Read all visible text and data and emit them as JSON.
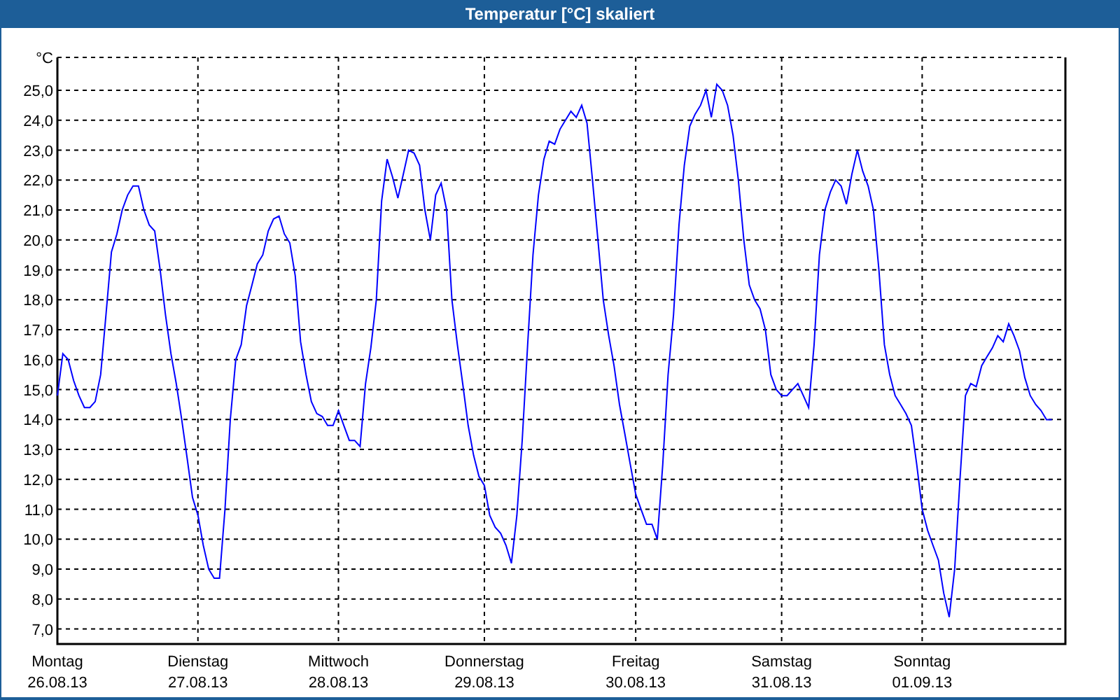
{
  "window": {
    "title": "Temperatur [°C] skaliert"
  },
  "chart": {
    "chart_data": {
      "type": "line",
      "grid": true,
      "ylabel": "°C",
      "ylim": [
        6.5,
        26.1
      ],
      "yticks": [
        {
          "value": 7,
          "label": "7,0"
        },
        {
          "value": 8,
          "label": "8,0"
        },
        {
          "value": 9,
          "label": "9,0"
        },
        {
          "value": 10,
          "label": "10,0"
        },
        {
          "value": 11,
          "label": "11,0"
        },
        {
          "value": 12,
          "label": "12,0"
        },
        {
          "value": 13,
          "label": "13,0"
        },
        {
          "value": 14,
          "label": "14,0"
        },
        {
          "value": 15,
          "label": "15,0"
        },
        {
          "value": 16,
          "label": "16,0"
        },
        {
          "value": 17,
          "label": "17,0"
        },
        {
          "value": 18,
          "label": "18,0"
        },
        {
          "value": 19,
          "label": "19,0"
        },
        {
          "value": 20,
          "label": "20,0"
        },
        {
          "value": 21,
          "label": "21,0"
        },
        {
          "value": 22,
          "label": "22,0"
        },
        {
          "value": 23,
          "label": "23,0"
        },
        {
          "value": 24,
          "label": "24,0"
        },
        {
          "value": 25,
          "label": "25,0"
        }
      ],
      "categories": [
        "Montag 26.08.13",
        null,
        null,
        null,
        null,
        null,
        null,
        null,
        null,
        null,
        null,
        null,
        null,
        null,
        null,
        null,
        null,
        null,
        null,
        null,
        null,
        null,
        null,
        null,
        null,
        null,
        "Dienstag 27.08.13",
        null,
        null,
        null,
        null,
        null,
        null,
        null,
        null,
        null,
        null,
        null,
        null,
        null,
        null,
        null,
        null,
        null,
        null,
        null,
        null,
        null,
        null,
        null,
        null,
        null,
        "Mittwoch 28.08.13",
        null,
        null,
        null,
        null,
        null,
        null,
        null,
        null,
        null,
        null,
        null,
        null,
        null,
        null,
        null,
        null,
        null,
        null,
        null,
        null,
        null,
        null,
        null,
        null,
        null,
        null,
        "Donnerstag 29.08.13",
        null,
        null,
        null,
        null,
        null,
        null,
        null,
        null,
        null,
        null,
        null,
        null,
        null,
        null,
        null,
        null,
        null,
        null,
        null,
        null,
        null,
        null,
        null,
        null,
        null,
        null,
        null,
        "Freitag 30.08.13",
        null,
        null,
        null,
        null,
        null,
        null,
        null,
        null,
        null,
        null,
        null,
        null,
        null,
        null,
        null,
        null,
        null,
        null,
        null,
        null,
        null,
        null,
        null,
        null,
        null,
        null,
        "Samstag 31.08.13",
        null,
        null,
        null,
        null,
        null,
        null,
        null,
        null,
        null,
        null,
        null,
        null,
        null,
        null,
        null,
        null,
        null,
        null,
        null,
        null,
        null,
        null,
        null,
        null,
        null,
        "Sonntag 01.09.13",
        null,
        null,
        null,
        null,
        null,
        null,
        null,
        null,
        null,
        null,
        null,
        null,
        null,
        null,
        null,
        null,
        null,
        null,
        null,
        null,
        null,
        null,
        null,
        null
      ],
      "series": [
        {
          "color": "#0000ff",
          "values": [
            14.8,
            16.2,
            16.0,
            15.3,
            14.8,
            14.4,
            14.4,
            14.6,
            15.5,
            17.5,
            19.6,
            20.2,
            21.0,
            21.5,
            21.8,
            21.8,
            21.0,
            20.5,
            20.3,
            19.0,
            17.5,
            16.2,
            15.2,
            14.0,
            12.7,
            11.4,
            10.8,
            9.8,
            9.0,
            8.7,
            8.7,
            11.0,
            14.0,
            16.0,
            16.5,
            17.8,
            18.5,
            19.2,
            19.5,
            20.3,
            20.7,
            20.8,
            20.2,
            19.9,
            18.8,
            16.6,
            15.5,
            14.6,
            14.2,
            14.1,
            13.8,
            13.8,
            14.3,
            13.8,
            13.3,
            13.3,
            13.1,
            15.2,
            16.4,
            18.0,
            21.3,
            22.7,
            22.1,
            21.4,
            22.2,
            23.0,
            22.9,
            22.5,
            21.0,
            20.0,
            21.5,
            21.9,
            21.0,
            18.0,
            16.5,
            15.2,
            13.8,
            12.8,
            12.1,
            11.8,
            10.8,
            10.4,
            10.2,
            9.8,
            9.2,
            10.8,
            13.3,
            16.5,
            19.5,
            21.5,
            22.7,
            23.3,
            23.2,
            23.7,
            24.0,
            24.3,
            24.1,
            24.5,
            23.9,
            22.0,
            20.0,
            18.0,
            16.8,
            15.8,
            14.5,
            13.5,
            12.5,
            11.5,
            11.0,
            10.5,
            10.5,
            10.0,
            12.5,
            15.5,
            17.5,
            20.5,
            22.5,
            23.8,
            24.2,
            24.5,
            25.0,
            24.1,
            25.2,
            25.0,
            24.5,
            23.5,
            22.0,
            20.0,
            18.5,
            18.0,
            17.7,
            17.0,
            15.5,
            15.0,
            14.8,
            14.8,
            15.0,
            15.2,
            14.8,
            14.4,
            16.5,
            19.5,
            21.0,
            21.6,
            22.0,
            21.8,
            21.2,
            22.2,
            23.0,
            22.3,
            21.8,
            21.0,
            19.0,
            16.5,
            15.5,
            14.8,
            14.5,
            14.2,
            13.8,
            12.5,
            11.0,
            10.3,
            9.8,
            9.3,
            8.2,
            7.4,
            9.0,
            12.0,
            14.8,
            15.2,
            15.1,
            15.8,
            16.1,
            16.4,
            16.8,
            16.6,
            17.2,
            16.8,
            16.3,
            15.4,
            14.8,
            14.5,
            14.3,
            14.0,
            14.0
          ]
        }
      ]
    }
  }
}
